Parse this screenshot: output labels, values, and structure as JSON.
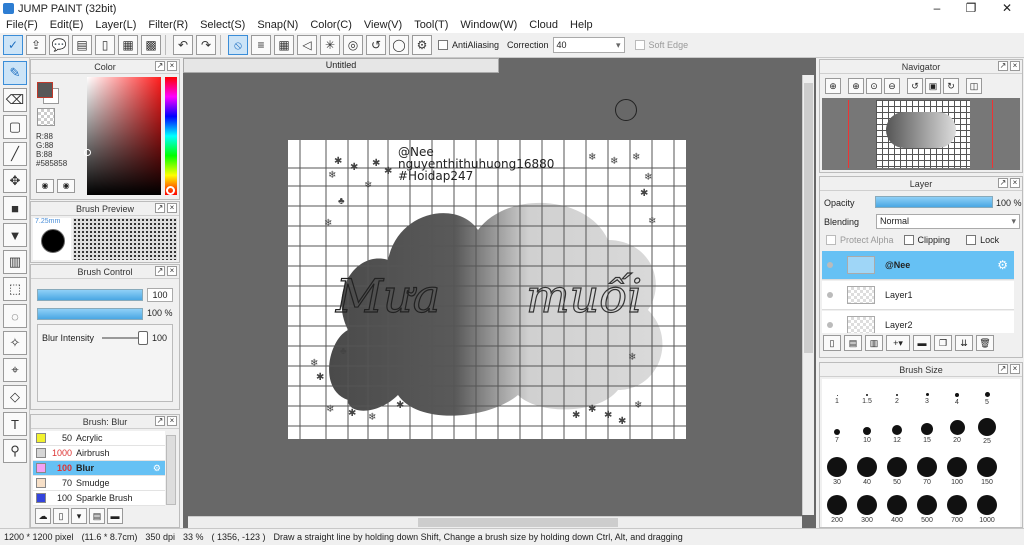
{
  "window": {
    "title": "JUMP PAINT (32bit)"
  },
  "menu": [
    "File(F)",
    "Edit(E)",
    "Layer(L)",
    "Filter(R)",
    "Select(S)",
    "Snap(N)",
    "Color(C)",
    "View(V)",
    "Tool(T)",
    "Window(W)",
    "Cloud",
    "Help"
  ],
  "toolbar": {
    "antialiasing_label": "AntiAliasing",
    "correction_label": "Correction",
    "correction_value": "40",
    "softedge_label": "Soft Edge"
  },
  "color_panel": {
    "title": "Color",
    "r": "R:88",
    "g": "G:88",
    "b": "B:88",
    "hex": "#585858",
    "fg_color": "#585858"
  },
  "brush_preview": {
    "title": "Brush Preview",
    "size": "7.25mm"
  },
  "brush_control": {
    "title": "Brush Control",
    "size_value": "100",
    "opacity_value": "100 %",
    "blur_label": "Blur Intensity",
    "blur_value": "100"
  },
  "brush_list": {
    "title": "Brush: Blur",
    "items": [
      {
        "value": "50",
        "name": "Acrylic",
        "color": "#f2f22e"
      },
      {
        "value": "1000",
        "name": "Airbrush",
        "color": "#d6d6d6"
      },
      {
        "value": "100",
        "name": "Blur",
        "color": "#f4a0f4"
      },
      {
        "value": "70",
        "name": "Smudge",
        "color": "#f7e0c8"
      },
      {
        "value": "100",
        "name": "Sparkle Brush",
        "color": "#3344dd"
      }
    ]
  },
  "canvas": {
    "tab_title": "Untitled",
    "text_line1": "@Nee",
    "text_line2": "nguyenthithuhuong16880",
    "text_line3": "#Hoidap247",
    "script_left": "Mưa",
    "script_right": "muối"
  },
  "navigator": {
    "title": "Navigator"
  },
  "layer_panel": {
    "title": "Layer",
    "opacity_label": "Opacity",
    "opacity_value": "100 %",
    "opacity_level": 1.0,
    "blending_label": "Blending",
    "blending_value": "Normal",
    "protect_alpha": "Protect Alpha",
    "clipping": "Clipping",
    "lock": "Lock",
    "layers": [
      "@Nee",
      "Layer1",
      "Layer2"
    ]
  },
  "brush_size": {
    "title": "Brush Size",
    "row1": [
      "1",
      "1.5",
      "2",
      "3",
      "4",
      "5"
    ],
    "row2": [
      "7",
      "10",
      "12",
      "15",
      "20",
      "25"
    ],
    "row3": [
      "30",
      "40",
      "50",
      "70",
      "100",
      "150"
    ],
    "row4": [
      "200",
      "300",
      "400",
      "500",
      "700",
      "1000"
    ]
  },
  "status": {
    "size": "1200 * 1200 pixel",
    "cm": "(11.6 * 8.7cm)",
    "dpi": "350 dpi",
    "zoom": "33 %",
    "coords": "( 1356, -123 )",
    "hint": "Draw a straight line by holding down Shift, Change a brush size by holding down Ctrl, Alt, and dragging"
  }
}
